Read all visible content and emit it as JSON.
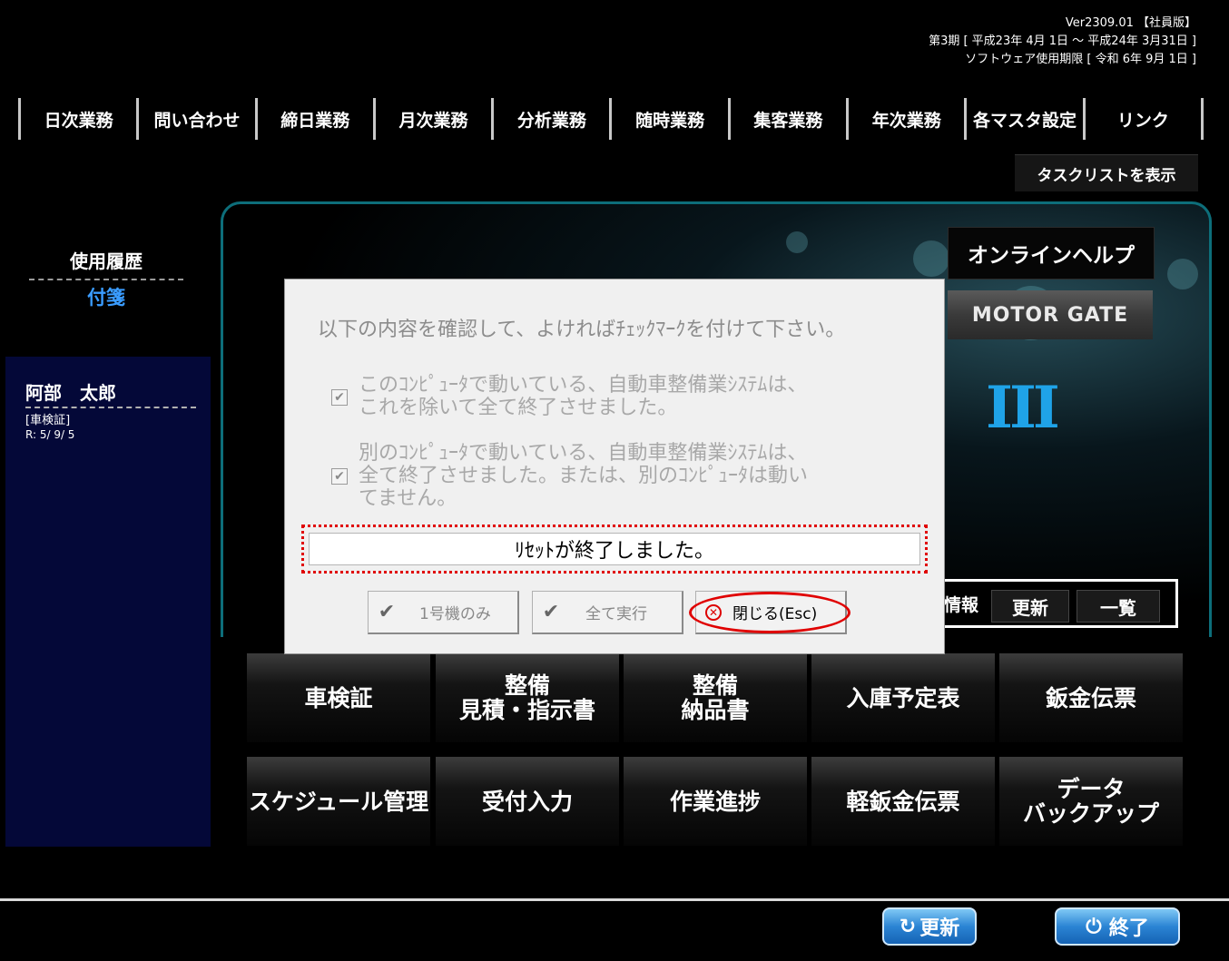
{
  "header": {
    "version": "Ver2309.01 【社員版】",
    "period": "第3期 [ 平成23年 4月 1日 ～ 平成24年 3月31日 ]",
    "license": "ソフトウェア使用期限 [ 令和 6年 9月 1日 ]"
  },
  "menu": [
    "日次業務",
    "問い合わせ",
    "締日業務",
    "月次業務",
    "分析業務",
    "随時業務",
    "集客業務",
    "年次業務",
    "各マスタ設定",
    "リンク"
  ],
  "task_list_button": "タスクリストを表示",
  "left": {
    "history_title": "使用履歴",
    "fusen": "付箋",
    "user_name": "阿部　太郎",
    "user_doc": "[車検証]",
    "user_date": "R: 5/ 9/ 5"
  },
  "right": {
    "online_help": "オンラインヘルプ",
    "motor_gate": "MOTOR GATE",
    "logo_numeral": "III",
    "info_label": "情報",
    "info_update": "更新",
    "info_list": "一覧"
  },
  "grid": [
    "車検証",
    "整備\n見積・指示書",
    "整備\n納品書",
    "入庫予定表",
    "鈑金伝票",
    "スケジュール管理",
    "受付入力",
    "作業進捗",
    "軽鈑金伝票",
    "データ\nバックアップ"
  ],
  "bottom": {
    "refresh": "更新",
    "exit": "終了"
  },
  "dialog": {
    "message": "以下の内容を確認して、よければﾁｪｯｸﾏｰｸを付けて下さい。",
    "check1": "このｺﾝﾋﾟｭｰﾀで動いている、自動車整備業ｼｽﾃﾑは、\nこれを除いて全て終了させました。",
    "check2": "別のｺﾝﾋﾟｭｰﾀで動いている、自動車整備業ｼｽﾃﾑは、\n全て終了させました。または、別のｺﾝﾋﾟｭｰﾀは動い\nてません。",
    "status": "ﾘｾｯﾄが終了しました。",
    "btn_unit1": "1号機のみ",
    "btn_all": "全て実行",
    "btn_close": "閉じる(Esc)"
  },
  "colors": {
    "accent_blue": "#3a9cff",
    "highlight_red": "#e00000",
    "frame_teal": "#0d6e7a",
    "left_panel": "#040838"
  }
}
